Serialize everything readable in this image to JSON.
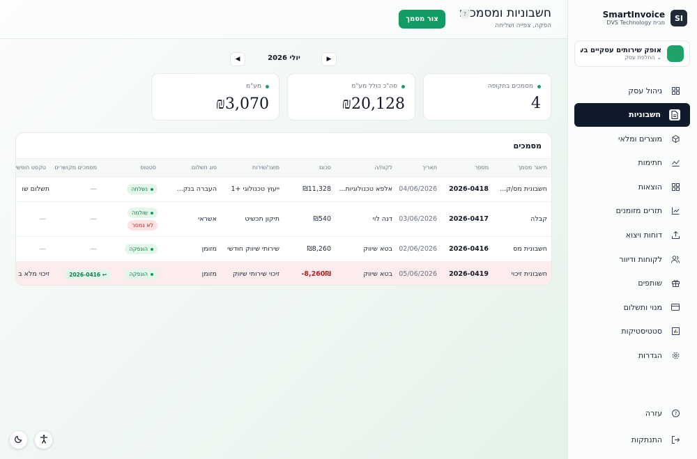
{
  "brand": {
    "name": "SmartInvoice",
    "sub": "DVS Technology מבית",
    "logo": "SI"
  },
  "business": {
    "name": "אופק שירותים עסקיים בע...",
    "switch_label": "החלפת עסק"
  },
  "nav": [
    {
      "label": "ניהול עסק",
      "icon": "grid-icon"
    },
    {
      "label": "חשבוניות",
      "icon": "document-icon",
      "active": true
    },
    {
      "label": "מוצרים ומלאי",
      "icon": "box-icon"
    },
    {
      "label": "חתימות",
      "icon": "signature-icon"
    },
    {
      "label": "הוצאות",
      "icon": "grid-icon"
    },
    {
      "label": "תזרים מזומנים",
      "icon": "trend-icon"
    },
    {
      "label": "דוחות ויצוא",
      "icon": "upload-icon"
    },
    {
      "label": "לקוחות ודיוור",
      "icon": "users-icon"
    },
    {
      "label": "שותפים",
      "icon": "gift-icon"
    },
    {
      "label": "מנוי ותשלום",
      "icon": "card-icon"
    },
    {
      "label": "סטטיסטיקות",
      "icon": "chart-icon"
    },
    {
      "label": "הגדרות",
      "icon": "gear-icon"
    }
  ],
  "bottom_nav": {
    "help": "עזרה",
    "logout": "התנתקות"
  },
  "header": {
    "title": "חשבוניות ומסמכים",
    "subtitle": "הפקה, צפייה ושליחה",
    "help_badge": "?",
    "create_button": "צור מסמך"
  },
  "month": {
    "label": "יולי 2026",
    "prev": "◀",
    "next": "▶"
  },
  "stats": [
    {
      "label": "מסמכים בתקופה",
      "value": "4"
    },
    {
      "label": "סה\"כ כולל מע\"מ",
      "value": "₪20,128"
    },
    {
      "label": "מע\"מ",
      "value": "₪3,070"
    }
  ],
  "table": {
    "title": "מסמכים",
    "columns": [
      "תיאור מסמך",
      "מספר",
      "תאריך",
      "לקוח/ה",
      "סכום",
      "מוצר/שירות",
      "סוג תשלום",
      "סטטוס",
      "מסמכים מקושרים",
      "טקסט חופשי"
    ],
    "rows": [
      {
        "type": "חשבונית מס/ק...",
        "number": "2026-0418",
        "date": "04/06/2026",
        "client": "אלפא טכנולוגיות...",
        "amount": "₪11,328",
        "product": "ייעוץ טכנולוגי +1",
        "payment": "העברה בנק...",
        "status": [
          "נשלחה"
        ],
        "linked": "—",
        "free_text": "תשלום שו"
      },
      {
        "type": "קבלה",
        "number": "2026-0417",
        "date": "03/06/2026",
        "client": "דנה לוי",
        "amount": "₪540",
        "product": "תיקון תכשיט",
        "payment": "אשראי",
        "status": [
          "שולמה",
          "לא נמסר"
        ],
        "linked": "—",
        "free_text": "—"
      },
      {
        "type": "חשבונית מס",
        "number": "2026-0416",
        "date": "02/06/2026",
        "client": "בטא שיווק",
        "amount": "₪8,260",
        "product": "שירותי שיווק חודשי",
        "payment": "מזומן",
        "status": [
          "הונפקה"
        ],
        "linked": "—",
        "free_text": "—"
      },
      {
        "type": "חשבונית זיכוי",
        "number": "2026-0419",
        "date": "05/06/2026",
        "client": "בטא שיווק",
        "amount": "-8,260₪",
        "product": "זיכוי שירותי שיווק",
        "payment": "מזומן",
        "status": [
          "הונפקה"
        ],
        "linked": "2026-0416 ↩",
        "free_text": "זיכוי מלא ב"
      }
    ]
  },
  "floating": {
    "theme": "☾",
    "accessibility": "⚲"
  },
  "colors": {
    "accent": "#139b64",
    "nav_active": "#0f1a2b",
    "credit_row": "#fdecec"
  }
}
